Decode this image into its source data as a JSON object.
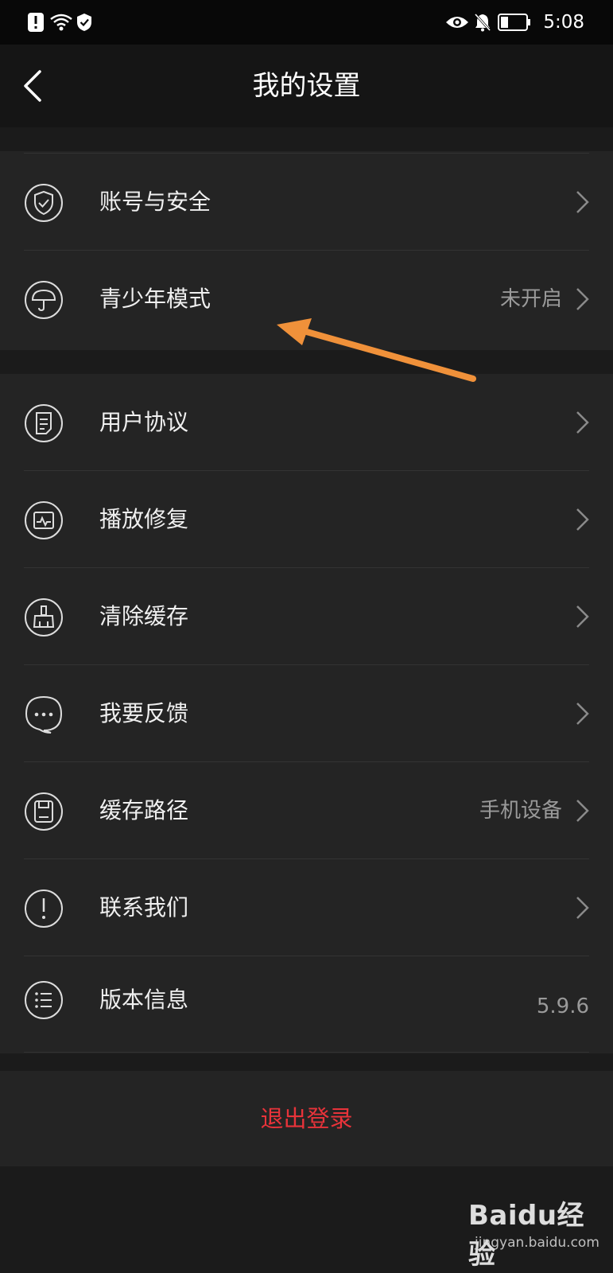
{
  "status_bar": {
    "time": "5:08"
  },
  "header": {
    "title": "我的设置"
  },
  "group1": [
    {
      "label": "账号与安全",
      "value": "",
      "icon": "shield-icon"
    },
    {
      "label": "青少年模式",
      "value": "未开启",
      "icon": "umbrella-icon"
    }
  ],
  "group2": [
    {
      "label": "用户协议",
      "value": "",
      "icon": "document-icon"
    },
    {
      "label": "播放修复",
      "value": "",
      "icon": "repair-icon"
    },
    {
      "label": "清除缓存",
      "value": "",
      "icon": "broom-icon"
    },
    {
      "label": "我要反馈",
      "value": "",
      "icon": "chat-icon"
    },
    {
      "label": "缓存路径",
      "value": "手机设备",
      "icon": "storage-icon"
    },
    {
      "label": "联系我们",
      "value": "",
      "icon": "info-icon"
    },
    {
      "label": "版本信息",
      "value": "5.9.6",
      "icon": "list-icon"
    }
  ],
  "logout": {
    "label": "退出登录"
  },
  "watermark": {
    "brand": "Baidu经验",
    "url": "jingyan.baidu.com"
  },
  "colors": {
    "accent_red": "#e8333a",
    "annotation_arrow": "#f0913a"
  }
}
